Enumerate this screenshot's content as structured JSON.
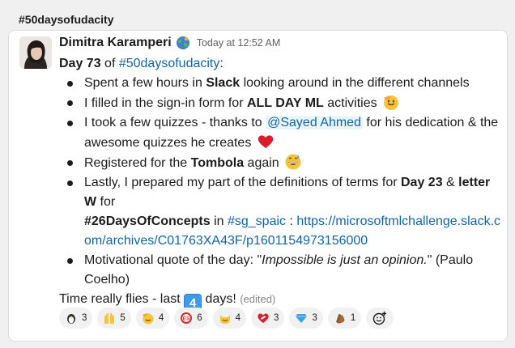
{
  "channel": {
    "name": "#50daysofudacity"
  },
  "message": {
    "author": "Dimitra Karamperi",
    "timestamp": "Today at 12:52 AM",
    "status_icon": "earth-globe-icon",
    "day_prefix": "Day 73",
    "day_of": " of ",
    "day_hashtag": "#50daysofudacity",
    "day_colon": ":",
    "bullets": {
      "b1": {
        "t1": "Spent a few hours in ",
        "bold": "Slack",
        "t2": " looking around in the different channels"
      },
      "b2": {
        "t1": "I filled in the sign-in form for ",
        "bold": "ALL DAY ML",
        "t2": " activities",
        "emoji": "saluting-face-icon"
      },
      "b3": {
        "t1": "I took a few quizzes - thanks to ",
        "mention": "@Sayed Ahmed",
        "t2": " for his dedication & the awesome quizzes he creates",
        "emoji": "red-heart-icon"
      },
      "b4": {
        "t1": "Registered for the ",
        "bold": "Tombola",
        "t2": " again",
        "emoji": "grinning-sweat-icon"
      },
      "b5": {
        "t1": "Lastly, I prepared my part of the definitions of terms for ",
        "bold1": "Day 23",
        "t2": " & ",
        "bold2": "letter W",
        "t3": " for ",
        "bold3": "#26DaysOfConcepts",
        "t4": " in ",
        "channel_link": "#sg_spaic",
        "t5": " : ",
        "url": "https://microsoftmlchallenge.slack.com/archives/C01763XA43F/p1601154973156000"
      },
      "b6": {
        "t1": "Motivational quote of the day: \"",
        "italic": "Impossible is just an opinion.",
        "t2": "\" (Paulo Coelho)"
      }
    },
    "footer": {
      "t1": "Time really flies - last ",
      "keycap": "4",
      "t2": " days! ",
      "edited": "(edited)"
    }
  },
  "reactions": [
    {
      "icon": "penguin-icon",
      "count": "3"
    },
    {
      "icon": "raised-hands-icon",
      "count": "5"
    },
    {
      "icon": "saluting-face-icon",
      "count": "4"
    },
    {
      "icon": "es-badge-icon",
      "count": "6"
    },
    {
      "icon": "smiling-cat-icon",
      "count": "4"
    },
    {
      "icon": "mending-heart-icon",
      "count": "3"
    },
    {
      "icon": "gem-icon",
      "count": "3"
    },
    {
      "icon": "clapping-hands-icon",
      "count": "1"
    }
  ],
  "add_reaction": {
    "icon": "add-reaction-icon"
  }
}
